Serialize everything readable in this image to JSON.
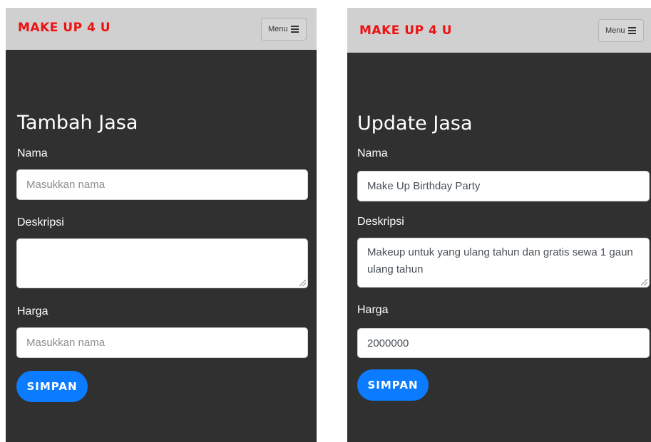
{
  "add_form": {
    "brand": "MAKE UP 4 U",
    "menu_label": "Menu",
    "title": "Tambah Jasa",
    "nama_label": "Nama",
    "nama_placeholder": "Masukkan nama",
    "deskripsi_label": "Deskripsi",
    "deskripsi_value": "",
    "harga_label": "Harga",
    "harga_placeholder": "Masukkan nama",
    "save_label": "SIMPAN"
  },
  "update_form": {
    "brand": "MAKE UP 4 U",
    "menu_label": "Menu",
    "title": "Update Jasa",
    "nama_label": "Nama",
    "nama_value": "Make Up Birthday Party",
    "deskripsi_label": "Deskripsi",
    "deskripsi_value": "Makeup untuk yang ulang tahun dan gratis sewa 1 gaun ulang tahun",
    "harga_label": "Harga",
    "harga_value": "2000000",
    "save_label": "SIMPAN"
  },
  "colors": {
    "brand": "#ee1111",
    "navbar": "#d0d0d0",
    "background": "#303030",
    "button": "#0b7bff"
  },
  "icons": {
    "menu": "hamburger-icon"
  }
}
